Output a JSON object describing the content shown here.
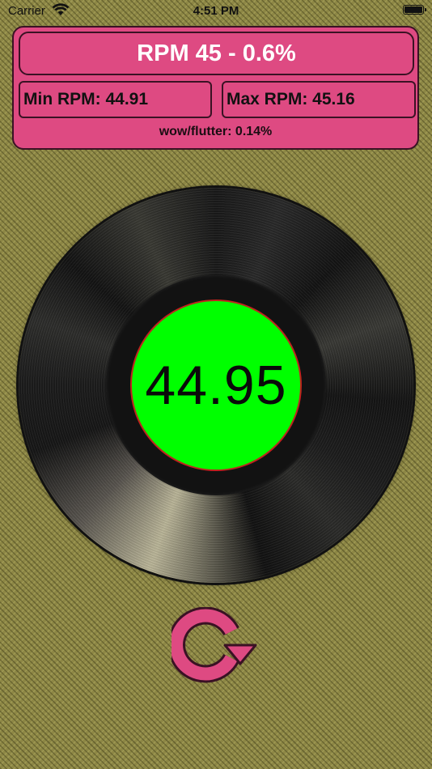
{
  "status_bar": {
    "carrier": "Carrier",
    "time": "4:51 PM"
  },
  "info": {
    "title": "RPM 45 - 0.6%",
    "min_rpm": "Min RPM: 44.91",
    "max_rpm": "Max RPM: 45.16",
    "wow_flutter": "wow/flutter: 0.14%"
  },
  "record": {
    "current_rpm": "44.95",
    "label_color": "#00ff00"
  },
  "controls": {
    "reset_icon": "refresh-icon"
  },
  "colors": {
    "panel": "#de4a82",
    "panel_border": "#3a1224",
    "accent_text": "#ffffff"
  }
}
